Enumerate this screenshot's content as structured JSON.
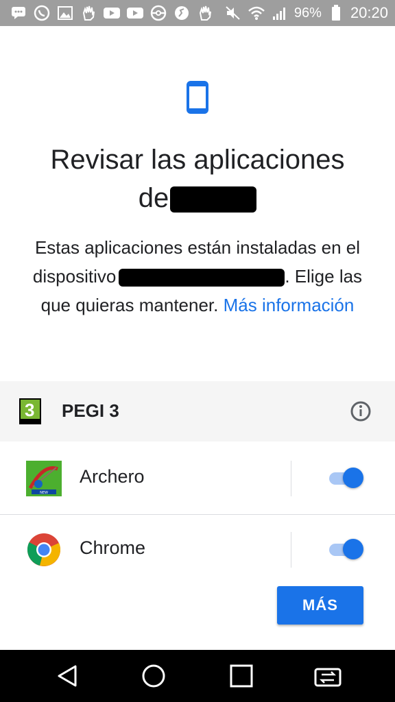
{
  "status_bar": {
    "battery": "96%",
    "time": "20:20",
    "notification_icons": [
      "message-icon",
      "whatsapp-icon",
      "image-icon",
      "hand-icon",
      "youtube-icon",
      "youtube-icon",
      "pokeball-icon",
      "sport-icon",
      "hand-icon"
    ]
  },
  "screen": {
    "title_line1": "Revisar las aplicaciones",
    "title_line2_prefix": "de",
    "description": "Estas aplicaciones están instaladas en el dispositivo",
    "description_line2": "Elige las que quieras mantener.",
    "more_info_link": "Más información"
  },
  "pegi": {
    "rating_number": "3",
    "label": "PEGI 3",
    "info_icon": "info-icon"
  },
  "apps": [
    {
      "name": "Archero",
      "icon": "archero-icon",
      "enabled": true
    },
    {
      "name": "Chrome",
      "icon": "chrome-icon",
      "enabled": true
    }
  ],
  "actions": {
    "more_button": "MÁS"
  },
  "colors": {
    "accent": "#1a73e8",
    "toggle_track": "#a9c7f5",
    "status_bar": "#9e9e9e",
    "pegi_green": "#7ab733"
  }
}
